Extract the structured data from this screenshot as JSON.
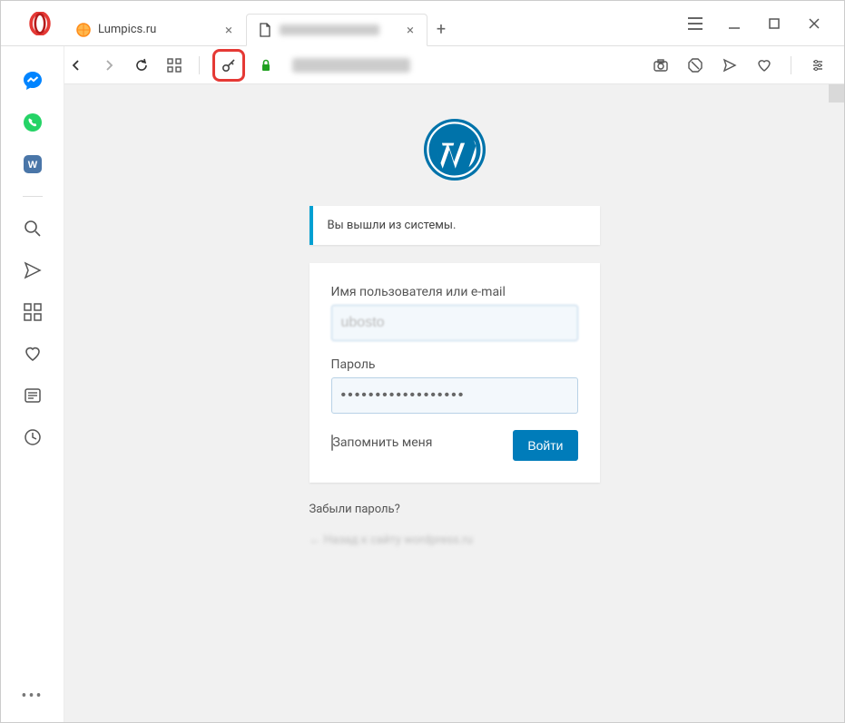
{
  "tabs": [
    {
      "label": "Lumpics.ru"
    },
    {
      "label": ""
    }
  ],
  "login": {
    "logout_message": "Вы вышли из системы.",
    "user_label": "Имя пользователя или e-mail",
    "user_value": "ubosto",
    "pass_label": "Пароль",
    "pass_value": "••••••••••••••••••",
    "remember": "Запомнить меня",
    "submit": "Войти",
    "forgot": "Забыли пароль?",
    "back": "← Назад к сайту wordpress.ru"
  }
}
